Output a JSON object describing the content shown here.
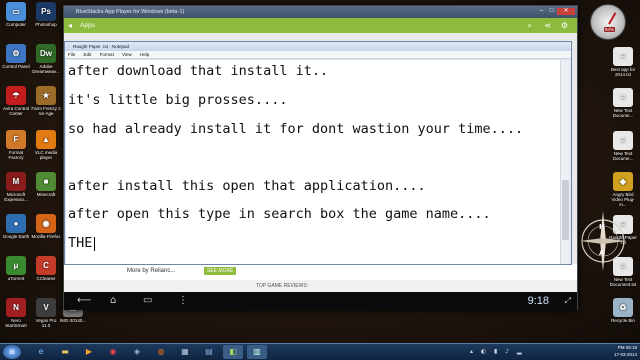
{
  "desktop": {
    "left_icons": [
      {
        "label": "Computer",
        "glyph": "▭",
        "color": "#4a8fd9"
      },
      {
        "label": "Photoshop",
        "glyph": "Ps",
        "color": "#1b3b66"
      },
      {
        "label": "Control Panel",
        "glyph": "⚙",
        "color": "#3d76c2"
      },
      {
        "label": "Adobe Dreamweav...",
        "glyph": "Dw",
        "color": "#2f6b27"
      },
      {
        "label": "Avira Control Center",
        "glyph": "☂",
        "color": "#c41d1d"
      },
      {
        "label": "Farm Frenzy 3 Ice Age",
        "glyph": "★",
        "color": "#9b6b2a"
      },
      {
        "label": "Format Factory",
        "glyph": "F",
        "color": "#d07a2a"
      },
      {
        "label": "VLC media player",
        "glyph": "▲",
        "color": "#e37b13"
      },
      {
        "label": "Microsoft Expressio...",
        "glyph": "M",
        "color": "#8a1c1c"
      },
      {
        "label": "Minecraft",
        "glyph": "■",
        "color": "#4f8a34"
      },
      {
        "label": "Google Earth",
        "glyph": "●",
        "color": "#2e6fb3"
      },
      {
        "label": "Mozilla Firefox",
        "glyph": "◉",
        "color": "#d66417"
      },
      {
        "label": "uTorrent",
        "glyph": "μ",
        "color": "#3a8b2f"
      },
      {
        "label": "CCleaner",
        "glyph": "C",
        "color": "#c43b2a"
      },
      {
        "label": "Nero StartSmart",
        "glyph": "N",
        "color": "#a11f1f"
      },
      {
        "label": "Vegas Pro 11.0",
        "glyph": "V",
        "color": "#3d3d3d"
      },
      {
        "label": "IMG-20140...",
        "glyph": "▣",
        "color": "#7a7a7a"
      }
    ],
    "right_icons": [
      {
        "label": "Best app for 2014.txt",
        "glyph": "≡",
        "color": "#e8e8e8"
      },
      {
        "label": "New Text Docume...",
        "glyph": "≡",
        "color": "#e8e8e8"
      },
      {
        "label": "New Text Docume...",
        "glyph": "≡",
        "color": "#e8e8e8"
      },
      {
        "label": "Angry Bird Video Plug-in...",
        "glyph": "◆",
        "color": "#d0a020"
      },
      {
        "label": "Raught Paper .txt",
        "glyph": "≡",
        "color": "#e8e8e8"
      },
      {
        "label": "New Text Document.txt",
        "glyph": "≡",
        "color": "#e8e8e8"
      },
      {
        "label": "Recycle Bin",
        "glyph": "♻",
        "color": "#9bb3c8"
      }
    ],
    "gauge_percent": "94%",
    "compass_letters": [
      "H",
      "A"
    ]
  },
  "bluestacks": {
    "title": "BlueStacks App Player for Windows (beta-1)",
    "apps_label": "Apps",
    "more_by_text": "More by Relianc...",
    "see_more": "SEE MORE",
    "top_game_reviews": "TOP GAME REVIEWS:",
    "time": "9:18"
  },
  "notepad": {
    "title": "Raught Paper .txt - Notepad",
    "menu": [
      "File",
      "Edit",
      "Format",
      "View",
      "Help"
    ],
    "lines": [
      "after download that install it..",
      "it's little big prosses....",
      "so had already install it for dont wastion your time....",
      "",
      "after install this open that application....",
      "after open this type in search box the game name....",
      "THE"
    ]
  },
  "taskbar": {
    "time": "PM 09:18",
    "date": "17-03-2014"
  }
}
